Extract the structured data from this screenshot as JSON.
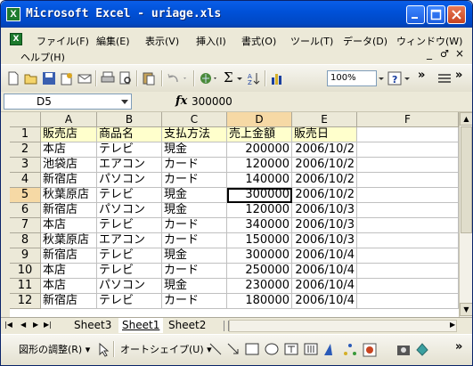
{
  "window": {
    "icon": "X",
    "title": "Microsoft Excel - uriage.xls"
  },
  "menu": [
    "ファイル(F)",
    "編集(E)",
    "表示(V)",
    "挿入(I)",
    "書式(O)",
    "ツール(T)",
    "データ(D)",
    "ウィンドウ(W)",
    "ヘルプ(H)"
  ],
  "doc_controls": [
    "_",
    "♂",
    "×"
  ],
  "toolbar": {
    "zoom": "100%",
    "sigma": "Σ",
    "overflow": "»"
  },
  "formula_bar": {
    "name_box": "D5",
    "fx_label": "fx",
    "formula": "300000"
  },
  "columns": [
    "A",
    "B",
    "C",
    "D",
    "E",
    "F"
  ],
  "rows": [
    {
      "n": "1",
      "cells": [
        "販売店",
        "商品名",
        "支払方法",
        "売上金額",
        "販売日",
        ""
      ]
    },
    {
      "n": "2",
      "cells": [
        "本店",
        "テレビ",
        "現金",
        "200000",
        "2006/10/2",
        ""
      ]
    },
    {
      "n": "3",
      "cells": [
        "池袋店",
        "エアコン",
        "カード",
        "120000",
        "2006/10/2",
        ""
      ]
    },
    {
      "n": "4",
      "cells": [
        "新宿店",
        "パソコン",
        "カード",
        "140000",
        "2006/10/2",
        ""
      ]
    },
    {
      "n": "5",
      "cells": [
        "秋葉原店",
        "テレビ",
        "現金",
        "300000",
        "2006/10/2",
        ""
      ]
    },
    {
      "n": "6",
      "cells": [
        "新宿店",
        "パソコン",
        "現金",
        "120000",
        "2006/10/3",
        ""
      ]
    },
    {
      "n": "7",
      "cells": [
        "本店",
        "テレビ",
        "カード",
        "340000",
        "2006/10/3",
        ""
      ]
    },
    {
      "n": "8",
      "cells": [
        "秋葉原店",
        "エアコン",
        "カード",
        "150000",
        "2006/10/3",
        ""
      ]
    },
    {
      "n": "9",
      "cells": [
        "新宿店",
        "テレビ",
        "現金",
        "300000",
        "2006/10/4",
        ""
      ]
    },
    {
      "n": "10",
      "cells": [
        "本店",
        "テレビ",
        "カード",
        "250000",
        "2006/10/4",
        ""
      ]
    },
    {
      "n": "11",
      "cells": [
        "本店",
        "パソコン",
        "現金",
        "230000",
        "2006/10/4",
        ""
      ]
    },
    {
      "n": "12",
      "cells": [
        "新宿店",
        "テレビ",
        "カード",
        "180000",
        "2006/10/4",
        ""
      ]
    }
  ],
  "active_cell": {
    "row": "5",
    "col": "D"
  },
  "sheet_tabs": [
    "Sheet3",
    "Sheet1",
    "Sheet2"
  ],
  "active_sheet": "Sheet1",
  "drawing_toolbar": {
    "adjust_label": "図形の調整(R) ▾",
    "autoshape_label": "オートシェイプ(U) ▾"
  }
}
